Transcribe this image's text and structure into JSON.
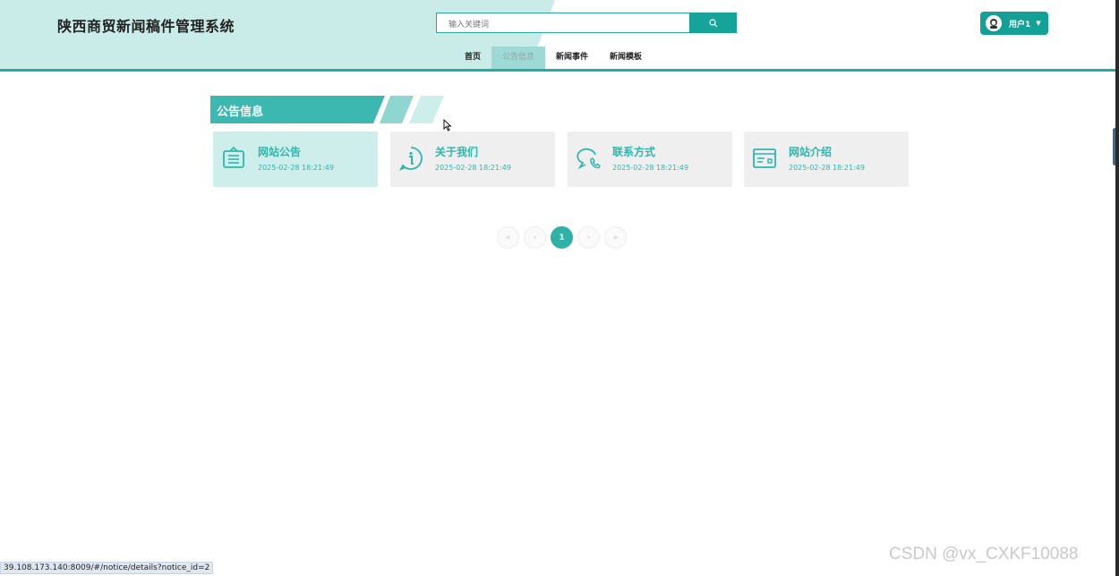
{
  "header": {
    "site_title": "陕西商贸新闻稿件管理系统",
    "search_placeholder": "输入关键词",
    "user_label": "用户1",
    "caret": "▼"
  },
  "nav": {
    "items": [
      {
        "label": "首页"
      },
      {
        "label": "公告信息"
      },
      {
        "label": "新闻事件"
      },
      {
        "label": "新闻模板"
      }
    ]
  },
  "section": {
    "title": "公告信息"
  },
  "cards": [
    {
      "title": "网站公告",
      "date": "2025-02-28 18:21:49",
      "icon": "notice-board-icon"
    },
    {
      "title": "关于我们",
      "date": "2025-02-28 18:21:49",
      "icon": "info-icon"
    },
    {
      "title": "联系方式",
      "date": "2025-02-28 18:21:49",
      "icon": "phone-chat-icon"
    },
    {
      "title": "网站介绍",
      "date": "2025-02-28 18:21:49",
      "icon": "browser-window-icon"
    }
  ],
  "pagination": {
    "first": "«",
    "prev": "‹",
    "current": "1",
    "next": "›",
    "last": "»"
  },
  "status_bar": {
    "url": "39.108.173.140:8009/#/notice/details?notice_id=2"
  },
  "watermark": {
    "text": "CSDN @vx_CXKF10088"
  },
  "colors": {
    "accent": "#22ada3",
    "card_active": "#cdeeeb",
    "card_text": "#2fb6ac"
  }
}
